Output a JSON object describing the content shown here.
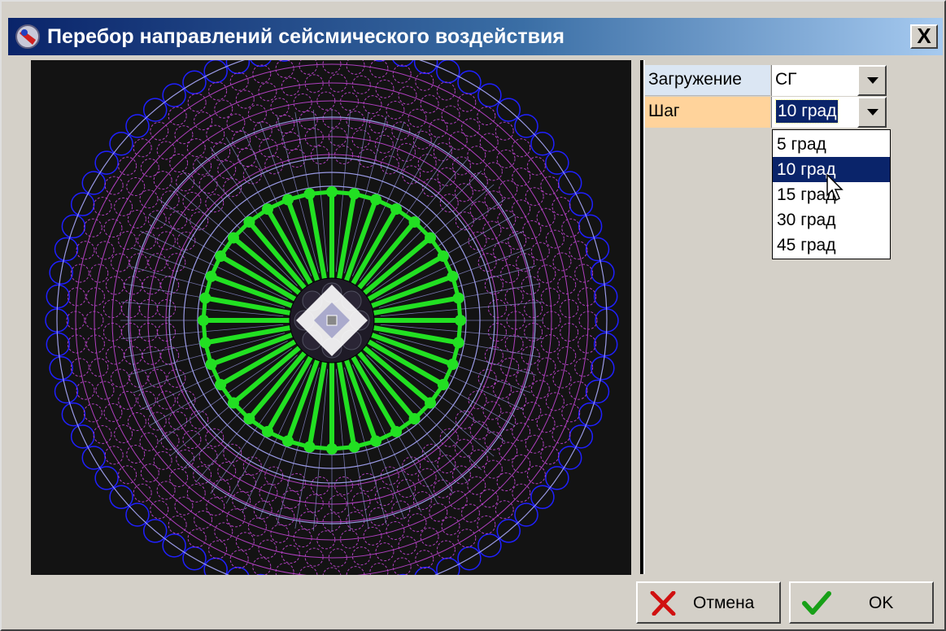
{
  "window": {
    "title": "Перебор направлений сейсмического воздействия",
    "close_glyph": "X"
  },
  "view": {
    "description_icon": "seismic-direction-plot",
    "colors": {
      "background": "#131313",
      "outer_ring": "#2020ff",
      "mesh": "#b040c0",
      "lines": "#9a9ae6",
      "directions": "#22e022",
      "core": "#ffffff"
    },
    "direction_count": 36
  },
  "params": {
    "load_label": "Загружение",
    "load_value": "СГ",
    "step_label": "Шаг",
    "step_value": "10 град"
  },
  "dropdown": {
    "options": [
      "5 град",
      "10 град",
      "15 град",
      "30 град",
      "45 град"
    ],
    "selected_index": 1
  },
  "buttons": {
    "cancel_label": "Отмена",
    "ok_label": "OK"
  }
}
